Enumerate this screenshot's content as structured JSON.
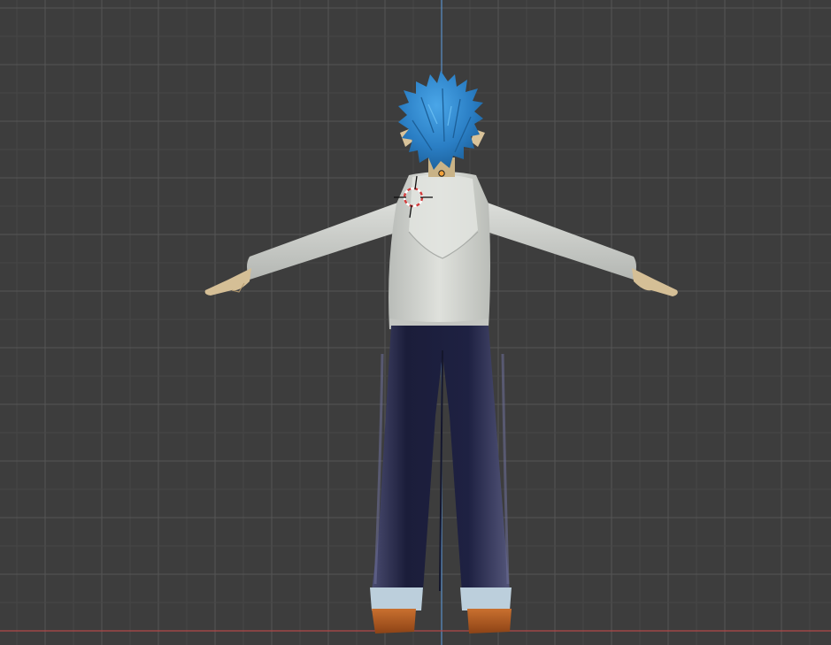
{
  "viewport": {
    "background_color": "#3d3d3d",
    "grid_minor_color": "#474747",
    "grid_major_color": "#555555",
    "z_axis_color": "#5a8fc8",
    "x_axis_color": "#b34848"
  },
  "character": {
    "hair_color": "#2f86c9",
    "skin_color": "#d9c39a",
    "shirt_color": "#d6d8d3",
    "pants_color": "#1e2140",
    "cuff_color": "#b9ccd8",
    "shoe_color": "#b05a22"
  },
  "gizmos": {
    "cursor_icon": "3d-cursor-icon",
    "origin_icon": "object-origin-icon",
    "cursor_ring_color": "#d23b3b",
    "origin_color": "#f2a23a"
  }
}
